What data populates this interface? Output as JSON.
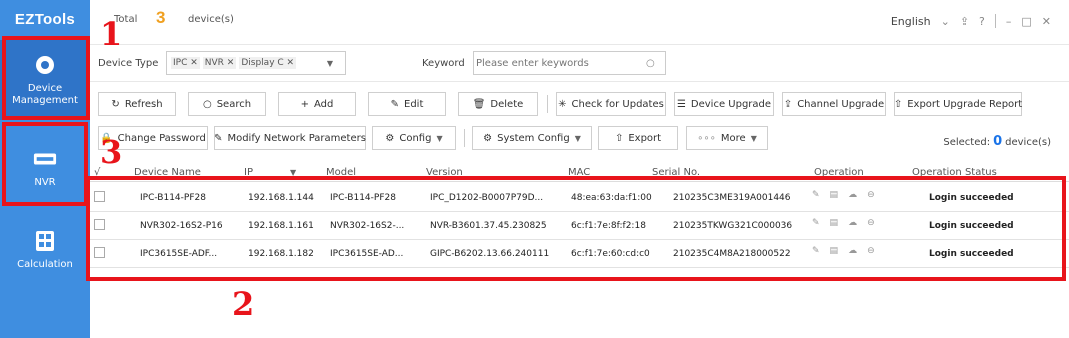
{
  "app": {
    "name": "EZTools"
  },
  "sidebar": {
    "items": [
      {
        "label_line1": "Device",
        "label_line2": "Management",
        "icon": "gear-icon"
      },
      {
        "label": "NVR",
        "icon": "nvr-icon"
      },
      {
        "label": "Calculation",
        "icon": "calculator-icon"
      }
    ]
  },
  "header": {
    "total_label": "Total",
    "total_count": "3",
    "devices_label": "device(s)",
    "language": "English"
  },
  "filter": {
    "device_type_label": "Device Type",
    "device_type_tags": [
      "IPC",
      "NVR",
      "Display C"
    ],
    "keyword_label": "Keyword",
    "keyword_placeholder": "Please enter keywords"
  },
  "toolbar": {
    "refresh": "Refresh",
    "search": "Search",
    "add": "Add",
    "edit": "Edit",
    "delete": "Delete",
    "check_updates": "Check for Updates",
    "device_upgrade": "Device Upgrade",
    "channel_upgrade": "Channel Upgrade",
    "export_report": "Export Upgrade Report"
  },
  "toolbar2": {
    "change_password": "Change Password",
    "modify_network": "Modify Network Parameters",
    "config": "Config",
    "system_config": "System Config",
    "export": "Export",
    "more": "More",
    "selected_label": "Selected:",
    "selected_count": "0",
    "selected_unit": "device(s)"
  },
  "table": {
    "columns": [
      "√",
      "Device Name",
      "IP",
      "Model",
      "Version",
      "MAC",
      "Serial No.",
      "Operation",
      "Operation Status"
    ],
    "rows": [
      {
        "name": "IPC-B114-PF28",
        "ip": "192.168.1.144",
        "model": "IPC-B114-PF28",
        "version": "IPC_D1202-B0007P79D...",
        "mac": "48:ea:63:da:f1:00",
        "serial": "210235C3ME319A001446",
        "status": "Login succeeded"
      },
      {
        "name": "NVR302-16S2-P16",
        "ip": "192.168.1.161",
        "model": "NVR302-16S2-...",
        "version": "NVR-B3601.37.45.230825",
        "mac": "6c:f1:7e:8f:f2:18",
        "serial": "210235TKWG321C000036",
        "status": "Login succeeded"
      },
      {
        "name": "IPC3615SE-ADF...",
        "ip": "192.168.1.182",
        "model": "IPC3615SE-AD...",
        "version": "GIPC-B6202.13.66.240111",
        "mac": "6c:f1:7e:60:cd:c0",
        "serial": "210235C4M8A218000522",
        "status": "Login succeeded"
      }
    ]
  },
  "annotations": {
    "label1": "1",
    "label2": "2",
    "label3": "3",
    "color": "#e8141b"
  },
  "colors": {
    "sidebar": "#3f8ee0",
    "sidebar_active": "#2f74c8",
    "accent_count": "#f0a020",
    "selected_count": "#1a73e8"
  }
}
